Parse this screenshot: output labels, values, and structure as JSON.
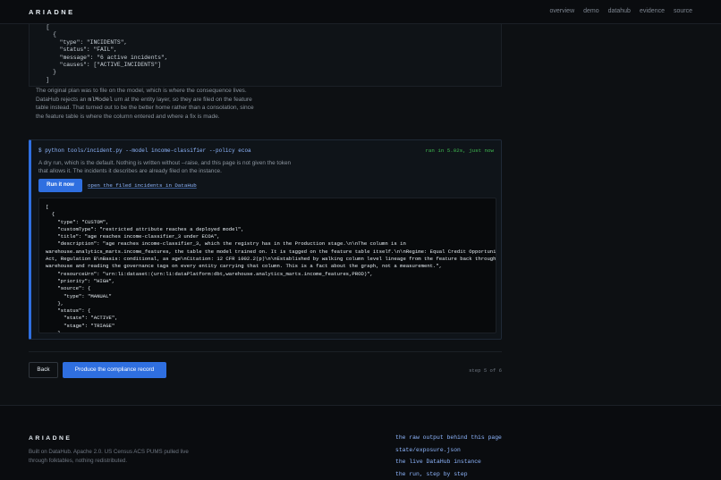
{
  "header": {
    "brand": "ARIADNE",
    "nav": [
      "overview",
      "demo",
      "datahub",
      "evidence",
      "source"
    ]
  },
  "top_code": "  [\n    {\n      \"type\": \"INCIDENTS\",\n      \"status\": \"FAIL\",\n      \"message\": \"6 active incidents\",\n      \"causes\": [\"ACTIVE_INCIDENTS\"]\n    }\n  ]",
  "explanation": {
    "before": "The original plan was to file on the model, which is where the consequence lives. DataHub rejects an ",
    "code": "mlModel",
    "after": " urn at the entity layer, so they are filed on the feature table instead. That turned out to be the better home rather than a consolation, since the feature table is where the column entered and where a fix is made."
  },
  "run_card": {
    "command": "$ python tools/incident.py --model income-classifier --policy ecoa",
    "status": "ran in 5.02s, just now",
    "description": "A dry run, which is the default. Nothing is written without --raise, and this page is not given the token that allows it. The incidents it describes are already filed on the instance.",
    "run_button": "Run it now",
    "filed_link": "open the filed incidents in DataHub",
    "output": "[\n  {\n    \"type\": \"CUSTOM\",\n    \"customType\": \"restricted attribute reaches a deployed model\",\n    \"title\": \"age reaches income-classifier_3 under ECOA\",\n    \"description\": \"age reaches income-classifier_3, which the registry has in the Production stage.\\n\\nThe column is in\nwarehouse.analytics_marts.income_features, the table the model trained on. It is tagged on the feature table itself.\\n\\nRegime: Equal Credit Opportunity\nAct, Regulation B\\nBasis: conditional, as age\\nCitation: 12 CFR 1002.2(p)\\n\\nEstablished by walking column level lineage from the feature back through the\nwarehouse and reading the governance tags on every entity carrying that column. This is a fact about the graph, not a measurement.\",\n    \"resourceUrn\": \"urn:li:dataset:(urn:li:dataPlatform:dbt,warehouse.analytics_marts.income_features,PROD)\",\n    \"priority\": \"HIGH\",\n    \"source\": {\n      \"type\": \"MANUAL\"\n    },\n    \"status\": {\n      \"state\": \"ACTIVE\",\n      \"stage\": \"TRIAGE\"\n    }"
  },
  "actions": {
    "back": "Back",
    "produce": "Produce the compliance record",
    "step": "step 5 of 6"
  },
  "footer": {
    "brand": "ARIADNE",
    "text": "Built on DataHub. Apache 2.0. US Census ACS PUMS pulled live through folktables, nothing redistributed.",
    "links": [
      "the raw output behind this page",
      "state/exposure.json",
      "the live DataHub instance",
      "the run, step by step"
    ]
  },
  "colors": {
    "accent": "#2f6fe0",
    "success": "#3fb950",
    "link": "#8fb7ff"
  }
}
